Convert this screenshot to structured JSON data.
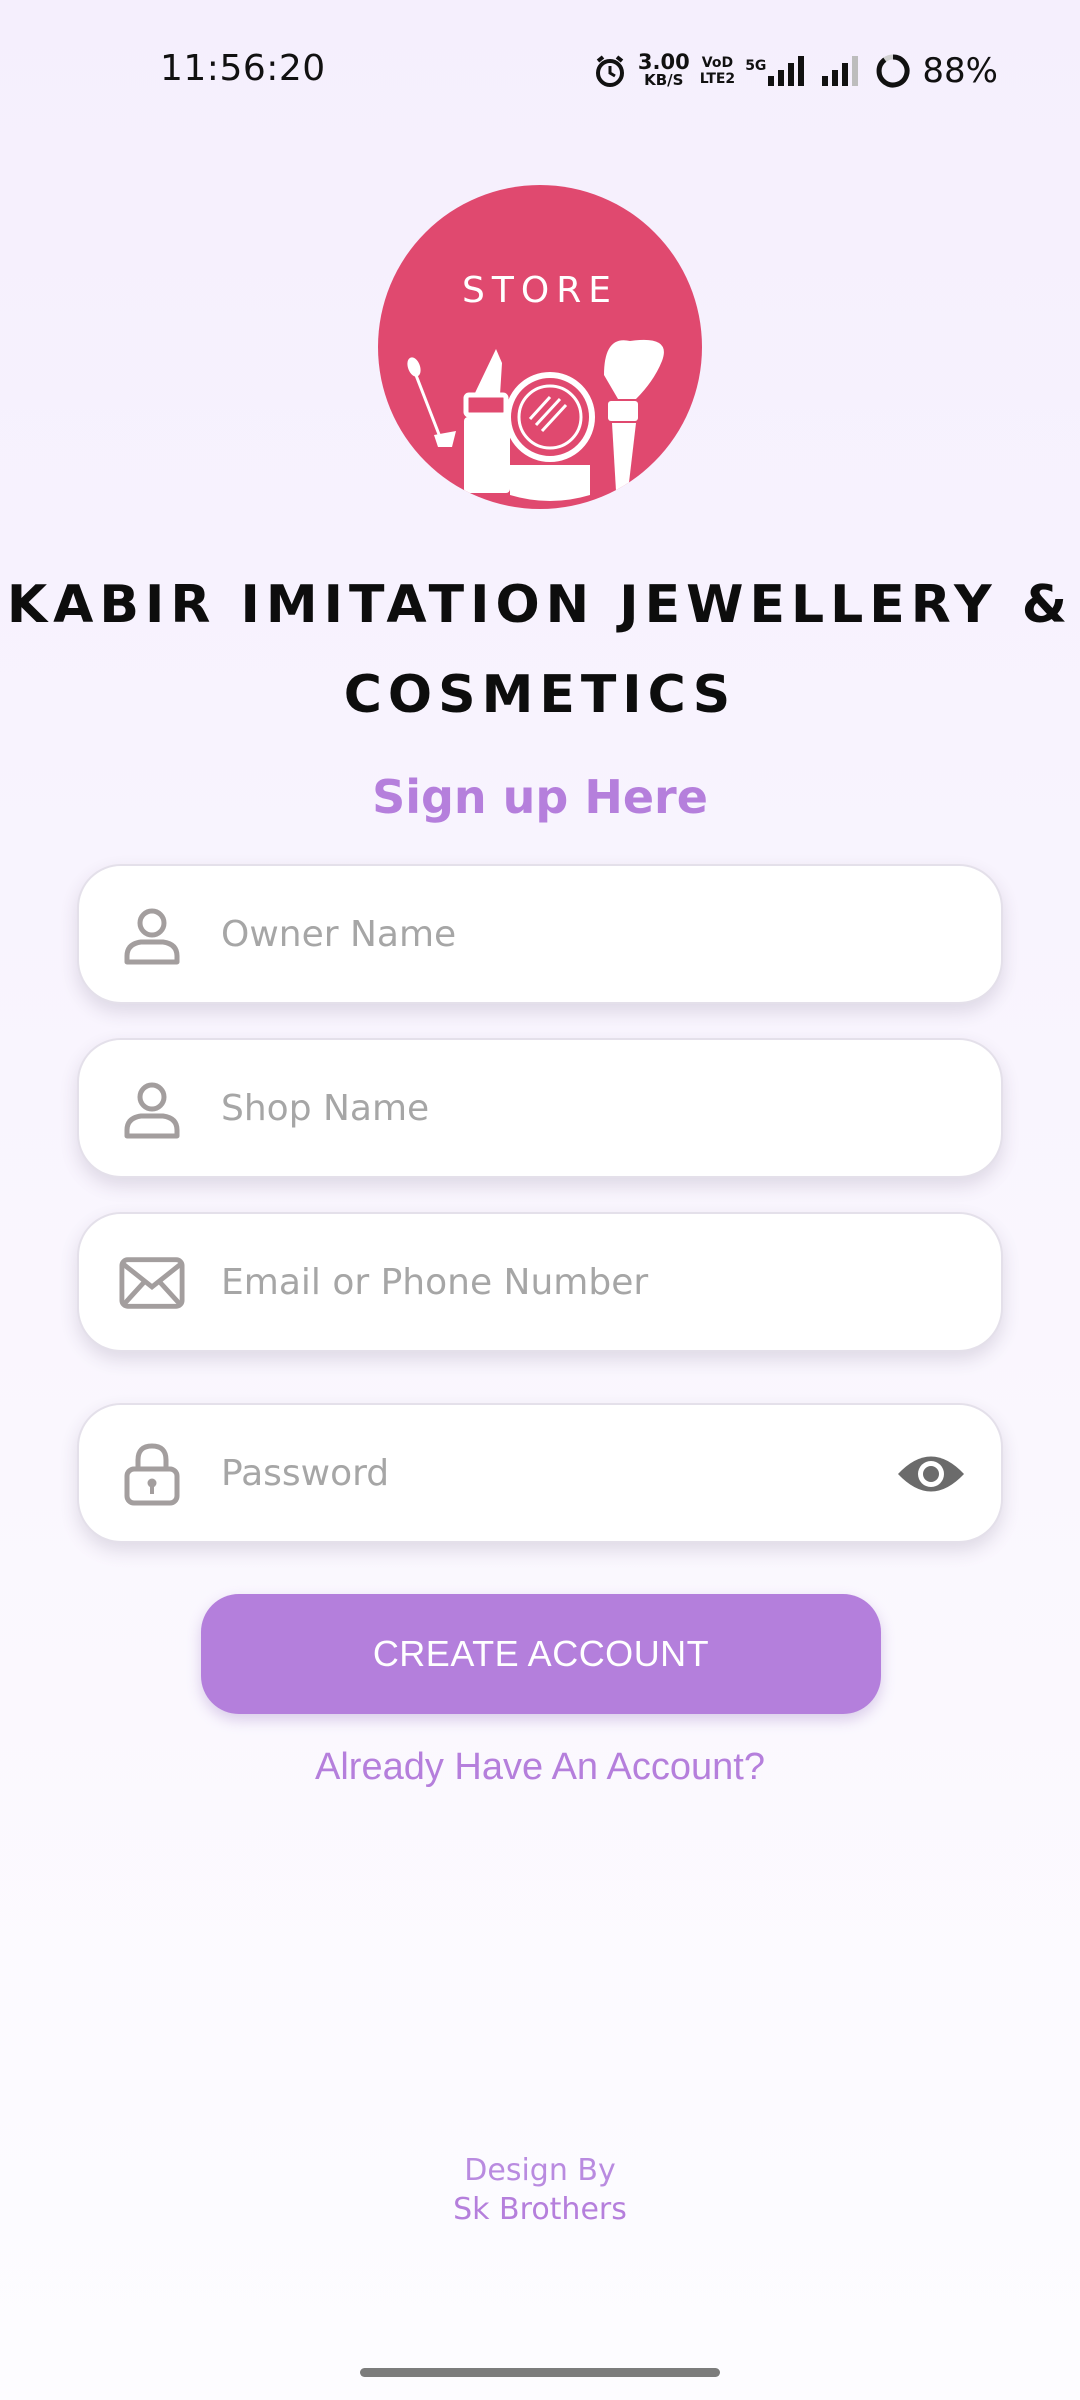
{
  "status_bar": {
    "time": "11:56:20",
    "net_speed_value": "3.00",
    "net_speed_unit": "KB/S",
    "volte_top": "VoD",
    "volte_bottom": "LTE2",
    "network_type": "5G",
    "battery": "88%"
  },
  "logo": {
    "text": "STORE",
    "color": "#e0496f"
  },
  "brand": {
    "line1": "KABIR IMITATION JEWELLERY &",
    "line2": "COSMETICS"
  },
  "form": {
    "title": "Sign up Here",
    "owner_name": {
      "placeholder": "Owner Name",
      "icon": "person-icon"
    },
    "shop_name": {
      "placeholder": "Shop Name",
      "icon": "person-icon"
    },
    "email_phone": {
      "placeholder": "Email or Phone Number",
      "icon": "mail-icon"
    },
    "password": {
      "placeholder": "Password",
      "icon": "lock-icon",
      "toggle_icon": "eye-icon"
    },
    "create_label": "CREATE ACCOUNT",
    "already_label": "Already Have An Account?"
  },
  "footer": {
    "design_by": "Design By",
    "designer": "Sk Brothers"
  },
  "colors": {
    "accent": "#b47fdc",
    "brand_pink": "#e0496f",
    "placeholder": "#a6a6a6"
  }
}
